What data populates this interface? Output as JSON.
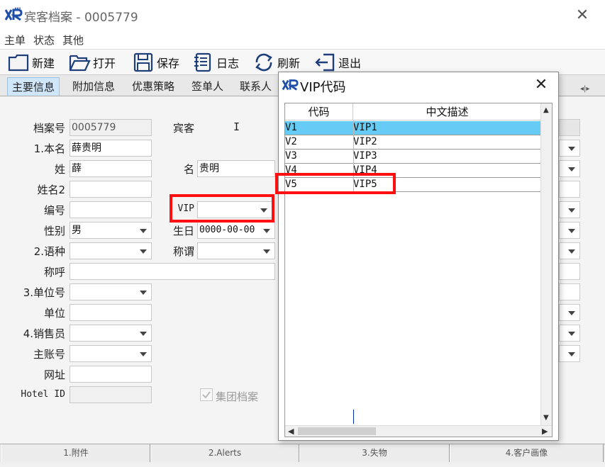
{
  "window": {
    "title": "宾客档案 - 0005779",
    "close_glyph": "✕"
  },
  "menu": [
    "主单",
    "状态",
    "其他"
  ],
  "toolbar": {
    "new_label": "新建",
    "open_label": "打开",
    "save_label": "保存",
    "log_label": "日志",
    "refresh_label": "刷新",
    "exit_label": "退出"
  },
  "tabs": [
    "主要信息",
    "附加信息",
    "优惠策略",
    "签单人",
    "联系人"
  ],
  "form": {
    "file_no_label": "档案号",
    "file_no_value": "0005779",
    "guest_label": "宾客",
    "guest_value": "I",
    "fullname_label": "1.本名",
    "fullname_value": "薛贵明",
    "surname_label": "姓",
    "surname_value": "薛",
    "givenname_label": "名",
    "givenname_value": "贵明",
    "surname2_label": "姓名2",
    "surname2_value": "",
    "number_label": "编号",
    "number_value": "",
    "vip_label": "VIP",
    "vip_value": "",
    "gender_label": "性别",
    "gender_value": "男",
    "birthday_label": "生日",
    "birthday_value": "0000-00-00",
    "language_label": "2.语种",
    "language_value": "",
    "title_label": "称谓",
    "title_value": "",
    "salutation_label": "称呼",
    "salutation_value": "",
    "company_no_label": "3.单位号",
    "company_no_value": "",
    "company_label": "单位",
    "company_value": "",
    "sales_label": "4.销售员",
    "sales_value": "",
    "master_acct_label": "主账号",
    "master_acct_value": "",
    "website_label": "网址",
    "website_value": "",
    "hotel_id_label": "Hotel ID",
    "hotel_id_value": "",
    "group_file_label": "集团档案",
    "group_file_checked": true
  },
  "bottom_tabs": [
    "1.附件",
    "2.Alerts",
    "3.失物",
    "4.客户画像"
  ],
  "popup": {
    "title": "VIP代码",
    "close_glyph": "✕",
    "columns": [
      "代码",
      "中文描述"
    ],
    "rows": [
      {
        "code": "V1",
        "desc": "VIP1"
      },
      {
        "code": "V2",
        "desc": "VIP2"
      },
      {
        "code": "V3",
        "desc": "VIP3"
      },
      {
        "code": "V4",
        "desc": "VIP4"
      },
      {
        "code": "V5",
        "desc": "VIP5"
      }
    ],
    "selected_row": 0
  },
  "colors": {
    "selection": "#66ccf5",
    "active_tab": "#cfe6fb",
    "highlight": "#ff1010",
    "logo": "#1f4fa8"
  },
  "icons": [
    "app-logo-icon",
    "new-icon",
    "open-icon",
    "save-icon",
    "log-icon",
    "refresh-icon",
    "exit-icon",
    "popup-logo-icon"
  ]
}
